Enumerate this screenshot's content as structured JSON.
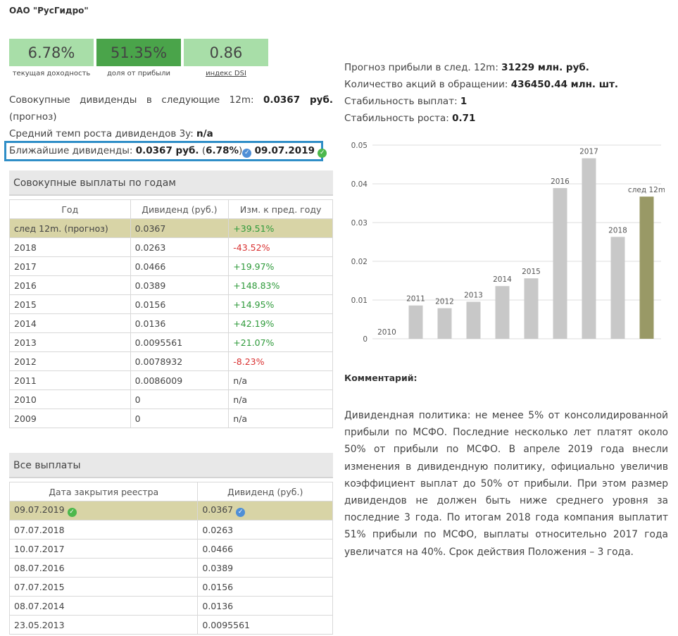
{
  "company": "ОАО \"РусГидро\"",
  "metrics": [
    {
      "value": "6.78%",
      "caption": "текущая доходность",
      "bg": "#a8dea8",
      "link": false
    },
    {
      "value": "51.35%",
      "caption": "доля от прибыли",
      "bg": "#4aa44a",
      "link": false
    },
    {
      "value": "0.86",
      "caption": "индекс DSI",
      "bg": "#a8dea8",
      "link": true
    }
  ],
  "summary": {
    "total_label": "Совокупные дивиденды в следующие 12m:",
    "total_value": "0.0367 руб.",
    "total_note": "(прогноз)",
    "growth_label": "Средний темп роста дивидендов 3y:",
    "growth_value": "n/a"
  },
  "nearest": {
    "label": "Ближайшие дивиденды:",
    "value": "0.0367 руб.",
    "yield_open": "(",
    "yield": "6.78%",
    "yield_close": ")",
    "date": "09.07.2019"
  },
  "yearly": {
    "title": "Совокупные выплаты по годам",
    "headers": [
      "Год",
      "Дивиденд (руб.)",
      "Изм. к пред. году"
    ],
    "rows": [
      [
        "след 12m. (прогноз)",
        "0.0367",
        "+39.51%"
      ],
      [
        "2018",
        "0.0263",
        "-43.52%"
      ],
      [
        "2017",
        "0.0466",
        "+19.97%"
      ],
      [
        "2016",
        "0.0389",
        "+148.83%"
      ],
      [
        "2015",
        "0.0156",
        "+14.95%"
      ],
      [
        "2014",
        "0.0136",
        "+42.19%"
      ],
      [
        "2013",
        "0.0095561",
        "+21.07%"
      ],
      [
        "2012",
        "0.0078932",
        "-8.23%"
      ],
      [
        "2011",
        "0.0086009",
        "n/a"
      ],
      [
        "2010",
        "0",
        "n/a"
      ],
      [
        "2009",
        "0",
        "n/a"
      ]
    ]
  },
  "payments": {
    "title": "Все выплаты",
    "headers": [
      "Дата закрытия реестра",
      "Дивиденд (руб.)"
    ],
    "rows": [
      [
        "09.07.2019",
        "0.0367"
      ],
      [
        "07.07.2018",
        "0.0263"
      ],
      [
        "10.07.2017",
        "0.0466"
      ],
      [
        "08.07.2016",
        "0.0389"
      ],
      [
        "07.07.2015",
        "0.0156"
      ],
      [
        "08.07.2014",
        "0.0136"
      ],
      [
        "23.05.2013",
        "0.0095561"
      ]
    ]
  },
  "forecast": {
    "profit_label": "Прогноз прибыли в след. 12m:",
    "profit_value": "31229 млн. руб.",
    "shares_label": "Количество акций в обращении:",
    "shares_value": "436450.44 млн. шт.",
    "stability_label": "Стабильность выплат:",
    "stability_value": "1",
    "growth_stab_label": "Стабильность роста:",
    "growth_stab_value": "0.71"
  },
  "chart_data": {
    "type": "bar",
    "categories": [
      "2010",
      "2011",
      "2012",
      "2013",
      "2014",
      "2015",
      "2016",
      "2017",
      "2018",
      "след 12m"
    ],
    "values": [
      0,
      0.0086009,
      0.0078932,
      0.0095561,
      0.0136,
      0.0156,
      0.0389,
      0.0466,
      0.0263,
      0.0367
    ],
    "ylim": [
      0,
      0.05
    ],
    "yticks": [
      "0",
      "0.01",
      "0.02",
      "0.03",
      "0.04",
      "0.05"
    ],
    "bar_color": "#c8c8c8",
    "highlight_color": "#999966",
    "grid": true
  },
  "comment": {
    "title": "Комментарий:",
    "text": "Дивидендная политика: не менее 5% от консолидированной прибыли по МСФО. Последние несколько лет платят около 50% от прибыли по МСФО. В апреле 2019 года внесли изменения в дивидендную политику, официально увеличив коэффициент выплат до 50% от прибыли. При этом размер дивидендов не должен быть ниже среднего уровня за последние 3 года. По итогам 2018 года компания выплатит 51% прибыли по МСФО, выплаты относительно 2017 года увеличатся на 40%. Срок действия Положения – 3 года."
  }
}
